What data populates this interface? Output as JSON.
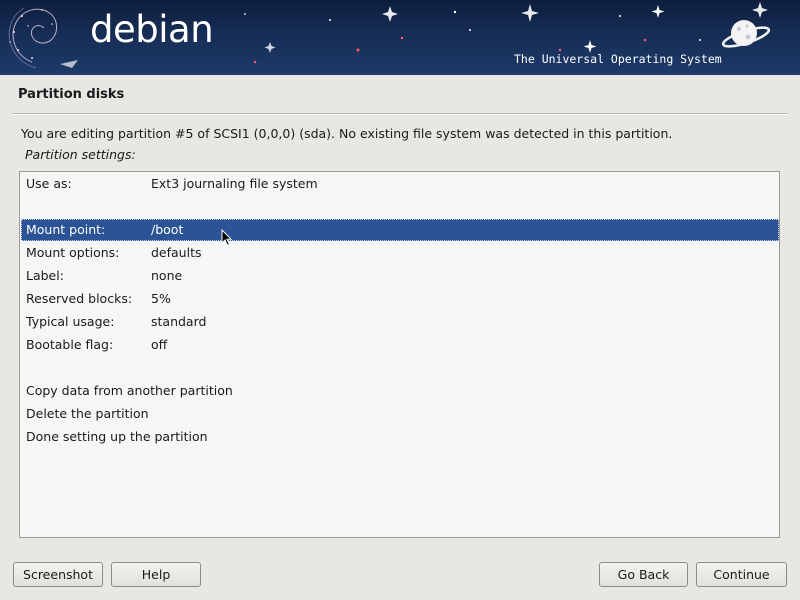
{
  "banner": {
    "logo_text": "debian",
    "tagline": "The Universal Operating System"
  },
  "page_title": "Partition disks",
  "intro_text": "You are editing partition #5 of SCSI1 (0,0,0) (sda). No existing file system was detected in this partition.",
  "subheading": "Partition settings:",
  "list": {
    "rows": [
      {
        "key": "Use as:",
        "value": "Ext3 journaling file system"
      },
      {
        "key": "Mount point:",
        "value": "/boot",
        "selected": true
      },
      {
        "key": "Mount options:",
        "value": "defaults"
      },
      {
        "key": "Label:",
        "value": "none"
      },
      {
        "key": "Reserved blocks:",
        "value": "5%"
      },
      {
        "key": "Typical usage:",
        "value": "standard"
      },
      {
        "key": "Bootable flag:",
        "value": "off"
      },
      {
        "key": "Copy data from another partition",
        "value": ""
      },
      {
        "key": "Delete the partition",
        "value": ""
      },
      {
        "key": "Done setting up the partition",
        "value": ""
      }
    ]
  },
  "buttons": {
    "screenshot": "Screenshot",
    "help": "Help",
    "go_back": "Go Back",
    "continue": "Continue"
  },
  "colors": {
    "selection": "#2b5395",
    "banner": "#162d55",
    "background": "#e8e7e3"
  }
}
